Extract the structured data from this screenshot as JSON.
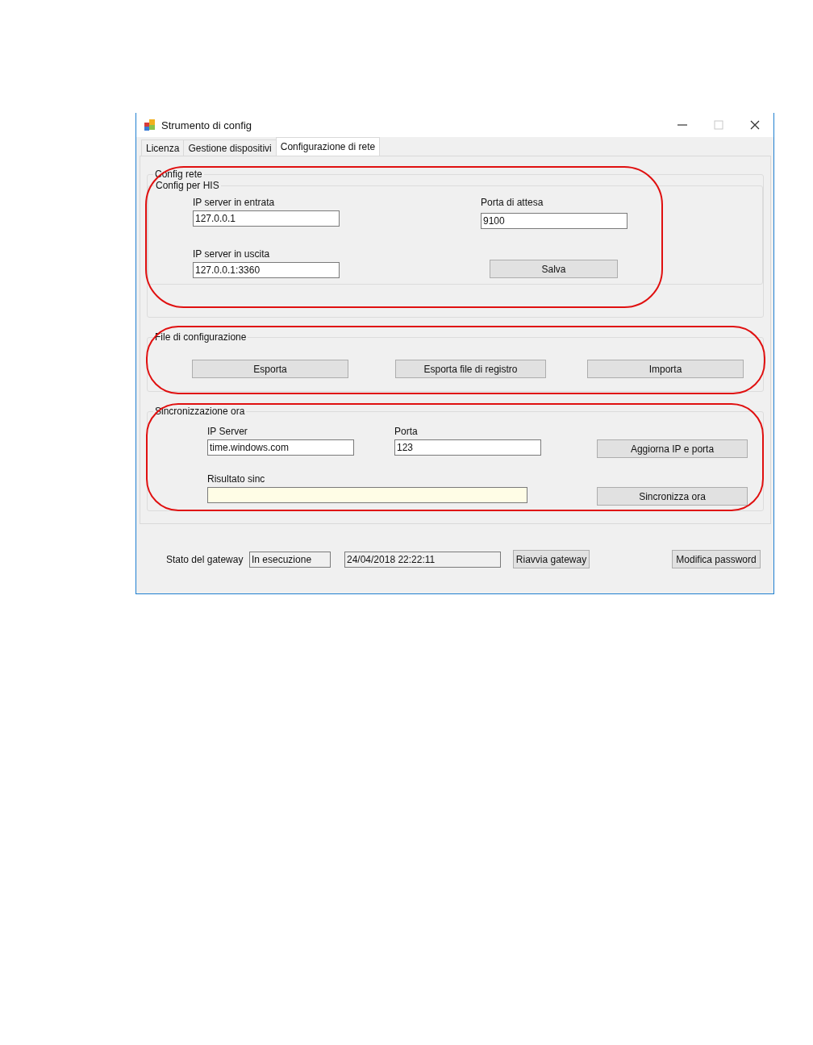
{
  "window": {
    "title": "Strumento di config"
  },
  "tabs": [
    {
      "label": "Licenza",
      "selected": false
    },
    {
      "label": "Gestione dispositivi",
      "selected": false
    },
    {
      "label": "Configurazione di rete",
      "selected": true
    }
  ],
  "network_config": {
    "title": "Config rete",
    "highlighted": true,
    "his": {
      "title": "Config per HIS",
      "fields": [
        {
          "label": "IP server in entrata",
          "value": "127.0.0.1"
        },
        {
          "label": "Porta di attesa",
          "value": "9100"
        },
        {
          "label": "IP server in uscita",
          "value": "127.0.0.1:3360"
        }
      ],
      "button": "Salva"
    }
  },
  "config_file": {
    "title": "File di configurazione",
    "highlighted": true,
    "buttons": [
      "Esporta",
      "Esporta file di registro",
      "Importa"
    ]
  },
  "time_sync": {
    "title": "Sincronizzazione ora",
    "highlighted": true,
    "fields": [
      {
        "label": "IP Server",
        "value": "time.windows.com"
      },
      {
        "label": "Porta",
        "value": "123"
      }
    ],
    "update_button": "Aggiorna IP e porta",
    "result": {
      "label": "Risultato sinc"
    },
    "sync_button": "Sincronizza ora"
  },
  "status": {
    "label": "Stato del gateway",
    "state": "In esecuzione",
    "timestamp": "24/04/2018 22:22:11",
    "restart_button": "Riavvia gateway",
    "password_button": "Modifica password"
  }
}
